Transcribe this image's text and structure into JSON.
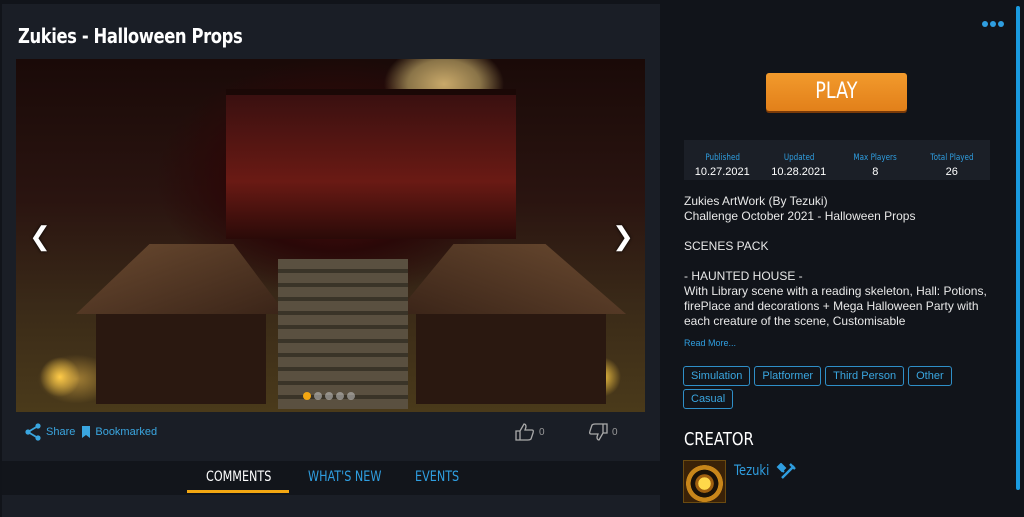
{
  "game": {
    "title": "Zukies - Halloween Props"
  },
  "gallery": {
    "prev_icon": "chevron-left-icon",
    "next_icon": "chevron-right-icon",
    "slide_count": 5,
    "active_slide": 1
  },
  "actions": {
    "share_label": "Share",
    "bookmark_label": "Bookmarked",
    "likes": "0",
    "dislikes": "0"
  },
  "tabs": [
    {
      "label": "COMMENTS",
      "active": true
    },
    {
      "label": "WHAT'S NEW",
      "active": false
    },
    {
      "label": "EVENTS",
      "active": false
    }
  ],
  "sidebar": {
    "play_label": "PLAY",
    "stats": [
      {
        "label": "Published",
        "value": "10.27.2021"
      },
      {
        "label": "Updated",
        "value": "10.28.2021"
      },
      {
        "label": "Max Players",
        "value": "8"
      },
      {
        "label": "Total Played",
        "value": "26"
      }
    ],
    "description": "Zukies ArtWork (By Tezuki)\nChallenge October 2021 - Halloween Props\n\nSCENES PACK\n\n- HAUNTED HOUSE -\nWith  Library scene with a reading skeleton, Hall: Potions, firePlace  and decorations + Mega Halloween Party with each creature of the scene, Customisable",
    "read_more_label": "Read More...",
    "tags": [
      "Simulation",
      "Platformer",
      "Third Person",
      "Other",
      "Casual"
    ],
    "creator_heading": "CREATOR",
    "creator_name": "Tezuki"
  },
  "colors": {
    "accent": "#2f9ee0",
    "play": "#e88a22",
    "active_tab_underline": "#f3a712"
  }
}
